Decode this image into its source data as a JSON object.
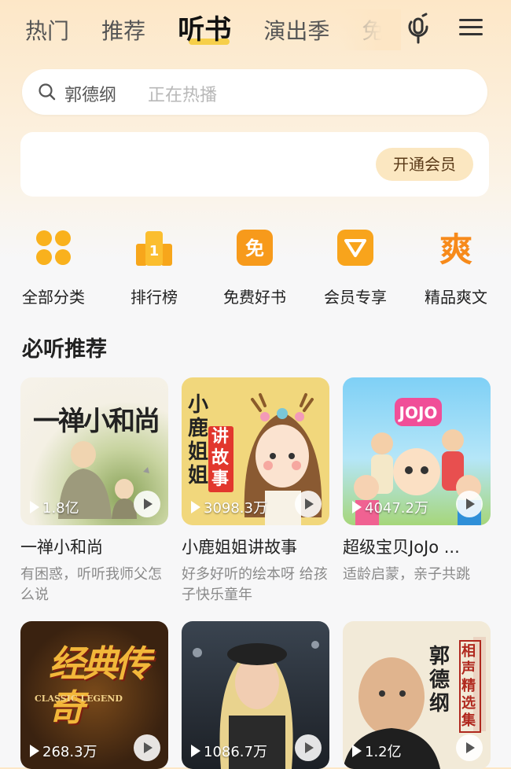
{
  "tabs": [
    {
      "label": "热门",
      "active": false
    },
    {
      "label": "推荐",
      "active": false
    },
    {
      "label": "听书",
      "active": true
    },
    {
      "label": "演出季",
      "active": false
    },
    {
      "label": "免",
      "active": false
    }
  ],
  "header_icons": {
    "voice": "microphone-icon",
    "menu": "menu-icon"
  },
  "search": {
    "keyword": "郭德纲",
    "hint": "正在热播"
  },
  "member": {
    "button_label": "开通会员"
  },
  "categories": [
    {
      "label": "全部分类",
      "icon": "grid-icon",
      "color": "#f9b11d"
    },
    {
      "label": "排行榜",
      "icon": "ranking-icon",
      "color": "#f7a61b"
    },
    {
      "label": "免费好书",
      "icon": "free-icon",
      "color": "#f79a1b",
      "glyph": "免"
    },
    {
      "label": "会员专享",
      "icon": "vip-icon",
      "color": "#f8a41c"
    },
    {
      "label": "精品爽文",
      "icon": "shuang-icon",
      "color": "#f78a1a",
      "glyph": "爽"
    }
  ],
  "section": {
    "title": "必听推荐"
  },
  "cards": [
    {
      "title": "一禅小和尚",
      "plays": "1.8亿",
      "desc": "有困惑，听听我师父怎么说",
      "art": "一禅小和尚"
    },
    {
      "title": "小鹿姐姐讲故事",
      "plays": "3098.3万",
      "desc": "好多好听的绘本呀 给孩子快乐童年",
      "art": "小鹿姐姐",
      "art2": "讲故事"
    },
    {
      "title": "超级宝贝JoJo ...",
      "plays": "4047.2万",
      "desc": "适龄启蒙，亲子共跳",
      "art": "JOJO"
    },
    {
      "title": "",
      "plays": "268.3万",
      "desc": "",
      "art": "经典传奇",
      "art2": "CLASSIC LEGEND"
    },
    {
      "title": "",
      "plays": "1086.7万",
      "desc": "",
      "art": ""
    },
    {
      "title": "",
      "plays": "1.2亿",
      "desc": "",
      "art": "郭德纲",
      "art2": "相声精选集"
    }
  ]
}
